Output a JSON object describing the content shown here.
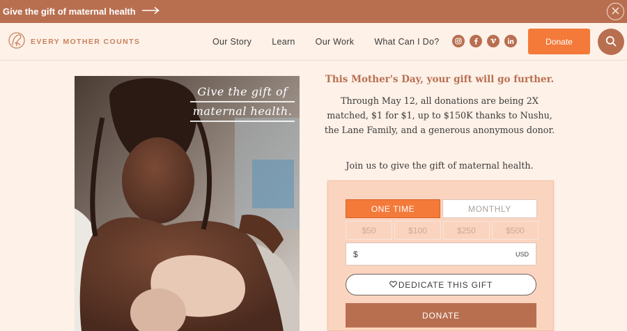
{
  "banner": {
    "text": "Give the gift of maternal health",
    "arrow_icon": "arrow-right-icon",
    "close_icon": "close-icon"
  },
  "nav": {
    "logo_text": "EVERY MOTHER COUNTS",
    "links": [
      "Our Story",
      "Learn",
      "Our Work",
      "What Can I Do?"
    ],
    "socials": [
      "instagram-icon",
      "facebook-icon",
      "vimeo-icon",
      "linkedin-icon"
    ],
    "donate_label": "Donate",
    "search_icon": "search-icon"
  },
  "hero": {
    "overlay_line1": "Give the gift of",
    "overlay_line2": "maternal health."
  },
  "content": {
    "heading": "This Mother's Day, your gift will go further.",
    "body": "Through May 12, all donations are being 2X matched, $1 for $1, up to $150K thanks to Nushu, the Lane Family, and a generous anonymous donor.",
    "join": "Join us to give the gift of maternal health."
  },
  "donation_form": {
    "frequency": [
      {
        "label": "ONE TIME",
        "selected": true
      },
      {
        "label": "MONTHLY",
        "selected": false
      }
    ],
    "amounts": [
      "$50",
      "$100",
      "$250",
      "$500"
    ],
    "currency_symbol": "$",
    "custom_value": "",
    "currency_code": "USD",
    "dedicate_label": "DEDICATE THIS GIFT",
    "dedicate_icon": "heart-icon",
    "donate_label": "DONATE"
  },
  "colors": {
    "brand": "#b86f50",
    "accent": "#f47a3a",
    "page_bg": "#fdf1e8",
    "card_bg": "#fbd4bf"
  }
}
